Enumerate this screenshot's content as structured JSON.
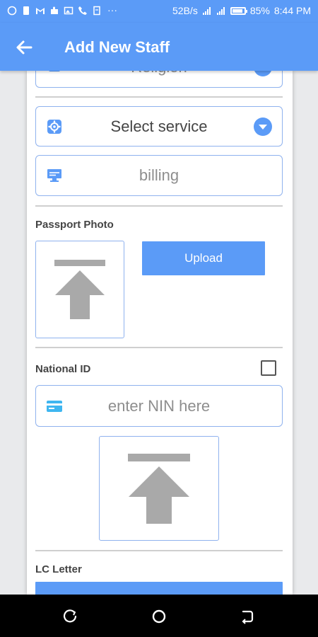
{
  "status_bar": {
    "speed": "52B/s",
    "battery": "85%",
    "time": "8:44 PM"
  },
  "app_bar": {
    "title": "Add New Staff"
  },
  "form": {
    "religion_field": {
      "value": "Religion"
    },
    "service_select": {
      "value": "Select service"
    },
    "billing_field": {
      "value": "billing"
    },
    "passport_photo": {
      "label": "Passport Photo",
      "upload_label": "Upload"
    },
    "national_id": {
      "label": "National ID",
      "checked": false,
      "nin_placeholder": "enter NIN here"
    },
    "lc_letter": {
      "label": "LC Letter"
    }
  },
  "colors": {
    "accent": "#5b9bf7",
    "field_border": "#8fb2ee",
    "card_background": "#ffffff",
    "nav_background": "#000000"
  }
}
